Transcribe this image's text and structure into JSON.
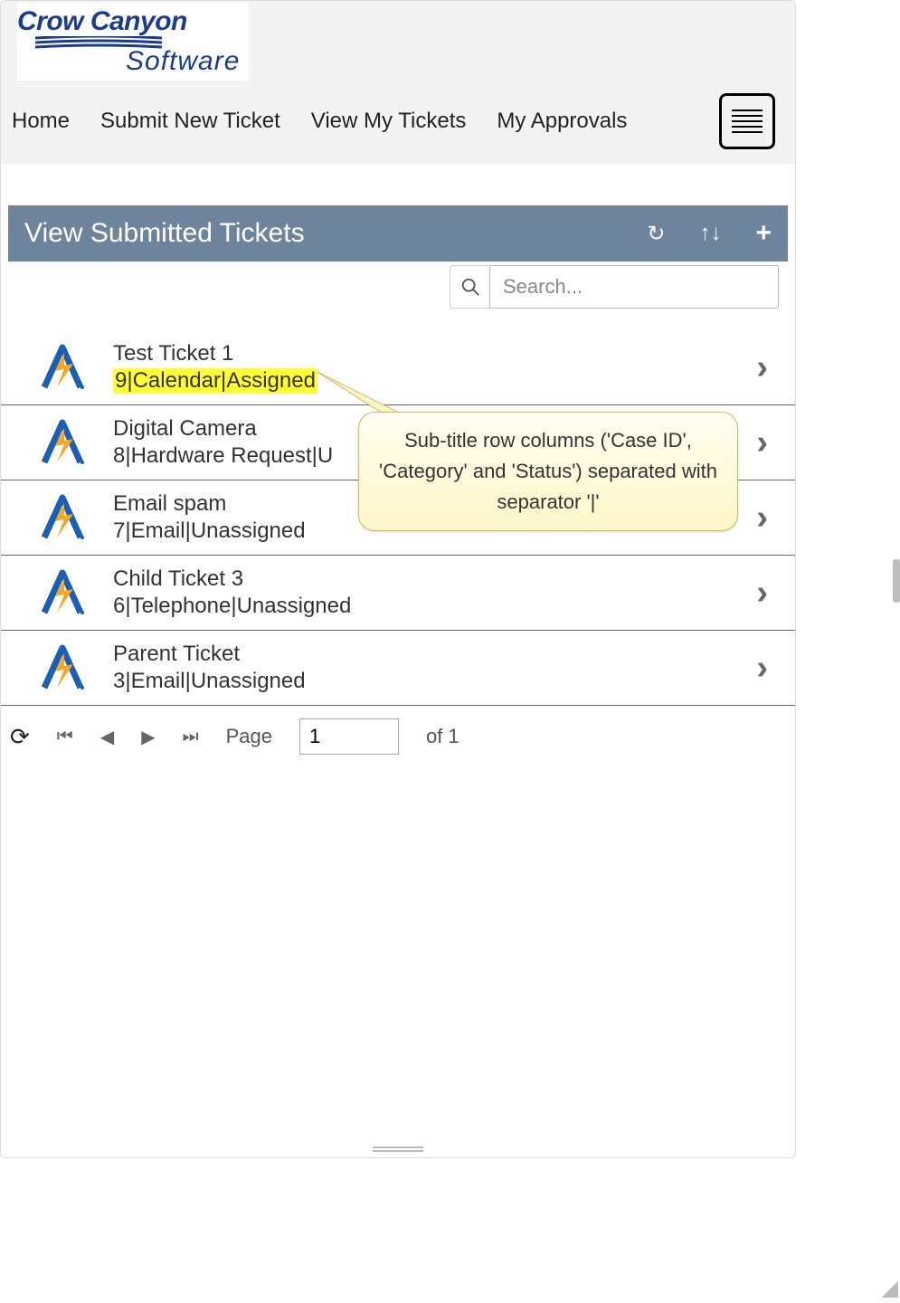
{
  "logo": {
    "line1": "Crow Canyon",
    "line2": "Software"
  },
  "nav": {
    "home": "Home",
    "submit": "Submit New Ticket",
    "view": "View My Tickets",
    "approvals": "My Approvals"
  },
  "section": {
    "title": "View Submitted Tickets"
  },
  "search": {
    "placeholder": "Search..."
  },
  "tickets": [
    {
      "title": "Test Ticket 1",
      "sub": "9|Calendar|Assigned",
      "highlight": true
    },
    {
      "title": "Digital Camera",
      "sub": "8|Hardware Request|U",
      "highlight": false
    },
    {
      "title": "Email spam",
      "sub": "7|Email|Unassigned",
      "highlight": false
    },
    {
      "title": "Child Ticket 3",
      "sub": "6|Telephone|Unassigned",
      "highlight": false
    },
    {
      "title": "Parent Ticket",
      "sub": "3|Email|Unassigned",
      "highlight": false
    }
  ],
  "pager": {
    "page_label": "Page",
    "page_value": "1",
    "of_label": "of 1"
  },
  "callout": {
    "text": "Sub-title row columns ('Case ID', 'Category' and 'Status') separated with separator '|'"
  }
}
